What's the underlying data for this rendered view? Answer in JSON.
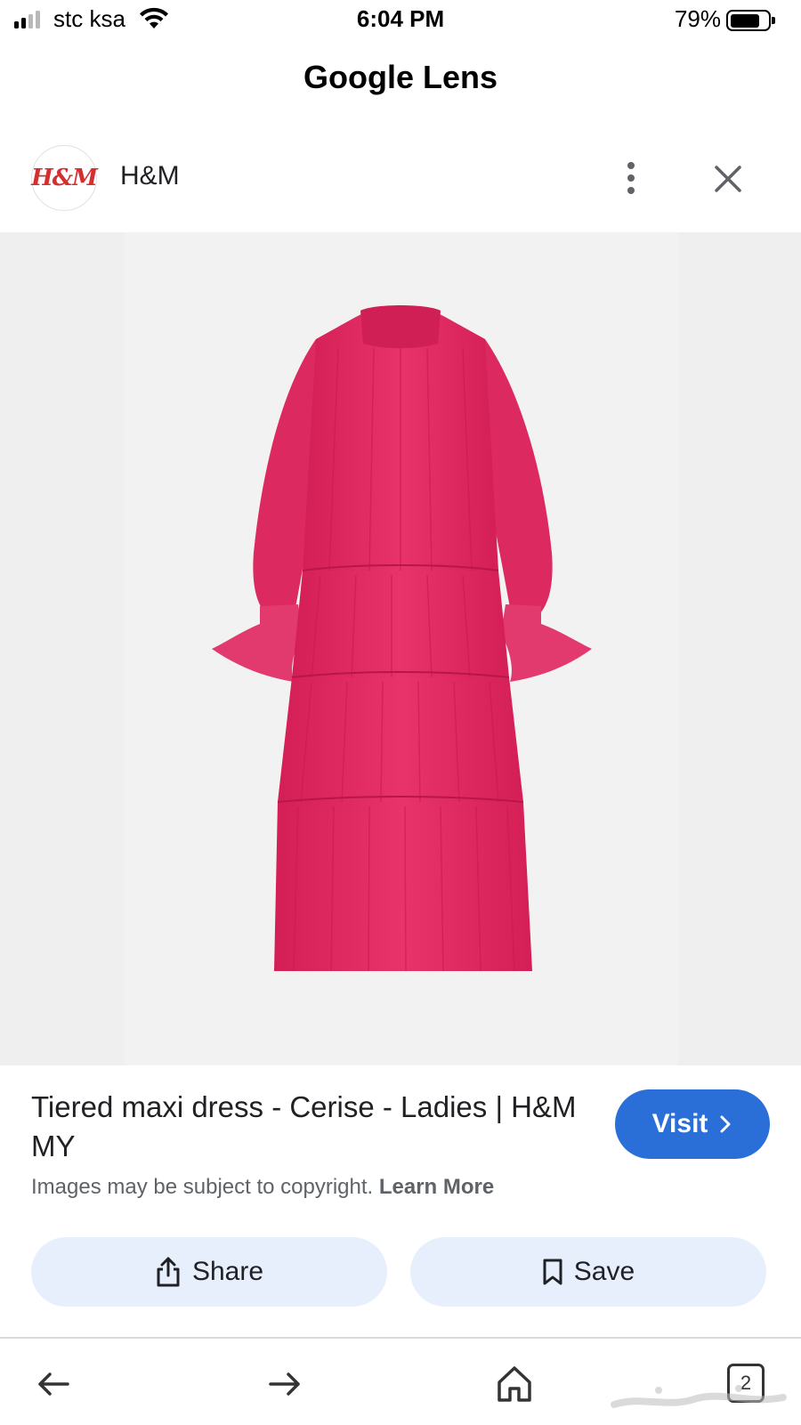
{
  "status_bar": {
    "carrier": "stc ksa",
    "time": "6:04 PM",
    "battery_percent": "79%",
    "battery_level": 0.79,
    "signal_bars": 2
  },
  "header": {
    "title": "Google Lens"
  },
  "source": {
    "logo_text": "H&M",
    "name": "H&M",
    "more_icon": "more-vertical-icon",
    "close_icon": "close-icon"
  },
  "product": {
    "image_description_color": "#e0245e",
    "title": "Tiered maxi dress - Cerise - Ladies | H&M MY",
    "visit_label": "Visit",
    "copyright_text": "Images may be subject to copyright.",
    "learn_more_label": "Learn More"
  },
  "actions": {
    "share_label": "Share",
    "save_label": "Save"
  },
  "bottom_nav": {
    "back_icon": "arrow-left-icon",
    "forward_icon": "arrow-right-icon",
    "home_icon": "home-icon",
    "tabs_count": "2"
  },
  "colors": {
    "accent": "#2a6fd8",
    "chip_background": "#e8effc",
    "brand_red": "#d32f2f",
    "dress": "#e0245e"
  }
}
